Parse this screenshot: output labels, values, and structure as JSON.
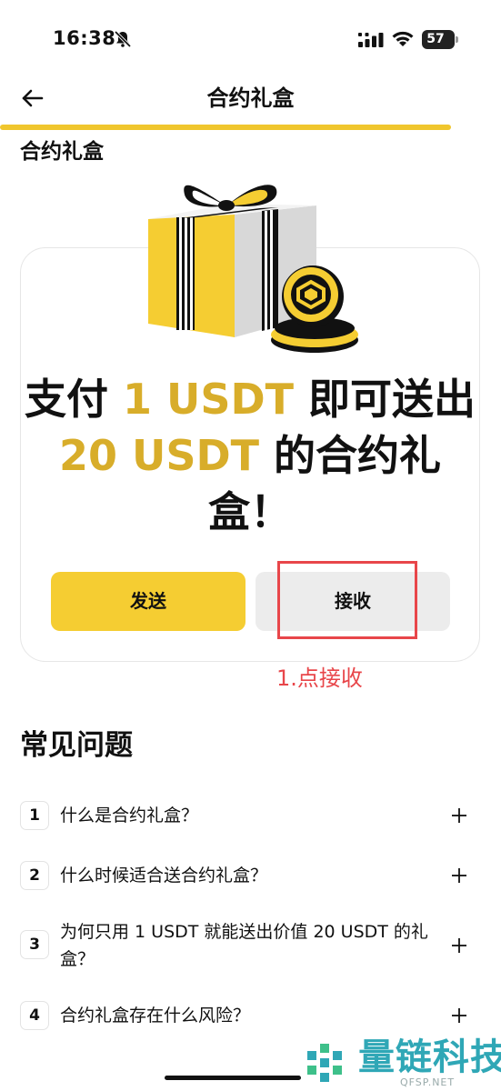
{
  "status_bar": {
    "time": "16:38",
    "battery": "57"
  },
  "nav": {
    "title": "合约礼盒"
  },
  "section": {
    "title": "合约礼盒"
  },
  "card": {
    "headline_part1": "支付 ",
    "headline_hl1": "1 USDT",
    "headline_part2": " 即可送出 ",
    "headline_hl2": "20 USDT",
    "headline_part3": " 的合约礼盒！",
    "send_label": "发送",
    "receive_label": "接收"
  },
  "annotation": {
    "text": "1.点接收"
  },
  "faq": {
    "title": "常见问题",
    "items": [
      {
        "num": "1",
        "question": "什么是合约礼盒？"
      },
      {
        "num": "2",
        "question": "什么时候适合送合约礼盒？"
      },
      {
        "num": "3",
        "question": "为何只用 1 USDT 就能送出价值 20 USDT 的礼盒？"
      },
      {
        "num": "4",
        "question": "合约礼盒存在什么风险？"
      }
    ]
  },
  "watermark": {
    "text": "量链科技",
    "sub": "QFSP.NET"
  },
  "colors": {
    "accent": "#f5cd32",
    "highlight": "#d8ad2a",
    "annotation": "#e8464a"
  },
  "icons": [
    "bell-slash-icon",
    "signal-icon",
    "wifi-icon",
    "battery-icon",
    "back-arrow-icon",
    "gift-box-icon",
    "plus-icon"
  ]
}
